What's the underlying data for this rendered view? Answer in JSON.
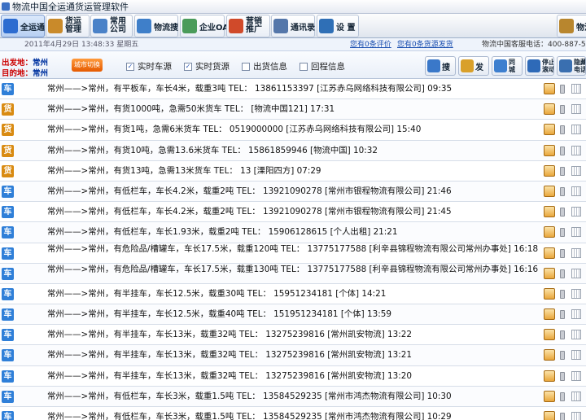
{
  "titlebar": {
    "title": "物流中国全运通货运管理软件"
  },
  "toolbar": {
    "items": [
      {
        "label": "全运通",
        "color": "#2d6cd0"
      },
      {
        "label": "货运\n管理",
        "color": "#c98a2a"
      },
      {
        "label": "常用\n公司",
        "color": "#4a82c8"
      },
      {
        "label": "物流搜",
        "color": "#3f7fc9"
      },
      {
        "label": "企业OA",
        "color": "#4a9b5a"
      },
      {
        "label": "营销\n推广",
        "color": "#d04a2a"
      },
      {
        "label": "通讯录",
        "color": "#5577aa"
      },
      {
        "label": "设 置",
        "color": "#2f6fb6"
      },
      {
        "label": "物流",
        "color": "#b8862e"
      }
    ]
  },
  "status": {
    "datetime": "2011年4月29日 13:48:33 星期五",
    "link1": "您有0条评价",
    "link2": "您有0条货源发货",
    "hotline": "物流中国客服电话：400-887-5"
  },
  "filter": {
    "origin_label": "出发地：",
    "origin": "常州",
    "dest_label": "目的地：",
    "dest": "常州",
    "switch": "城市切换",
    "checks": [
      {
        "label": "实时车源",
        "checked": true
      },
      {
        "label": "实时货源",
        "checked": true
      },
      {
        "label": "出货信息",
        "checked": false
      },
      {
        "label": "回程信息",
        "checked": false
      }
    ],
    "right_buttons": [
      {
        "label": "搜",
        "color": "#3a78c9"
      },
      {
        "label": "发",
        "color": "#d9a02a"
      },
      {
        "label": "同\n城",
        "color": "#3d7fcf"
      },
      {
        "label": "停止\n滚动",
        "color": "#2e6ab8"
      },
      {
        "label": "隐藏\n电话",
        "color": "#3a6fb0"
      }
    ]
  },
  "badges": {
    "car": "车",
    "goods": "货"
  },
  "rows": [
    {
      "type": "car",
      "text": "常州——>常州，有平板车，车长4米，载重3吨   TEL： 13861153397  [江苏赤乌网络科技有限公司]  09:35"
    },
    {
      "type": "goods",
      "text": "常州——>常州，有货1000吨，急需50米货车   TEL：   [物流中国121]  17:31"
    },
    {
      "type": "goods",
      "text": "常州——>常州，有货1吨，急需6米货车   TEL： 0519000000  [江苏赤乌网络科技有限公司]  15:40"
    },
    {
      "type": "goods",
      "text": "常州——>常州，有货10吨，急需13.6米货车   TEL： 15861859946  [物流中国]  10:32"
    },
    {
      "type": "goods",
      "text": "常州——>常州，有货13吨，急需13米货车   TEL： 13  [溧阳四方]  07:29"
    },
    {
      "type": "car",
      "text": "常州——>常州，有低栏车，车长4.2米，载重2吨   TEL： 13921090278  [常州市银程物流有限公司]  21:46"
    },
    {
      "type": "car",
      "text": "常州——>常州，有低栏车，车长4.2米，载重2吨   TEL： 13921090278  [常州市银程物流有限公司]  21:45"
    },
    {
      "type": "car",
      "text": "常州——>常州，有低栏车，车长1.93米，载重2吨   TEL： 15906128615  [个人出租]  21:21"
    },
    {
      "type": "car",
      "two": true,
      "text": "常州——>常州，有危险品/槽罐车，车长17.5米，载重120吨   TEL： 13775177588  [利辛县锦程物流有限公司常州办事处]  16:18"
    },
    {
      "type": "car",
      "two": true,
      "text": "常州——>常州，有危险品/槽罐车，车长17.5米，载重130吨   TEL： 13775177588  [利辛县锦程物流有限公司常州办事处]  16:16"
    },
    {
      "type": "car",
      "text": "常州——>常州，有半挂车，车长12.5米，载重30吨   TEL： 15951234181   [个体]  14:21"
    },
    {
      "type": "car",
      "text": "常州——>常州，有半挂车，车长12.5米，载重40吨   TEL： 151951234181   [个体]  13:59"
    },
    {
      "type": "car",
      "text": "常州——>常州，有半挂车，车长13米，载重32吨   TEL： 13275239816  [常州凯安物流]  13:22"
    },
    {
      "type": "car",
      "text": "常州——>常州，有半挂车，车长13米，载重32吨   TEL： 13275239816  [常州凯安物流]  13:21"
    },
    {
      "type": "car",
      "text": "常州——>常州，有半挂车，车长13米，载重32吨   TEL： 13275239816  [常州凯安物流]  13:20"
    },
    {
      "type": "car",
      "text": "常州——>常州，有低栏车，车长3米，载重1.5吨   TEL： 13584529235  [常州市鸿杰物流有限公司]  10:30"
    },
    {
      "type": "car",
      "text": "常州——>常州，有低栏车，车长3米，载重1.5吨   TEL： 13584529235  [常州市鸿杰物流有限公司]  10:29"
    }
  ]
}
